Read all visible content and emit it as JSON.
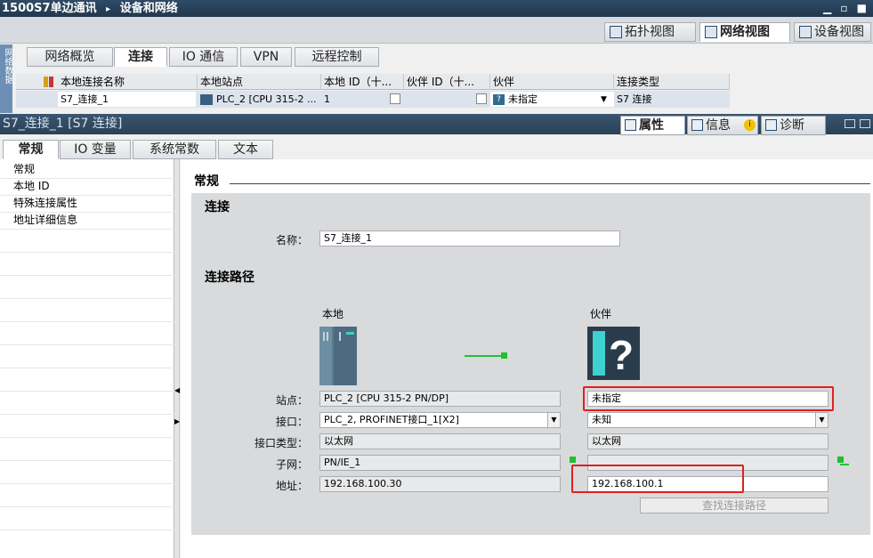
{
  "title": {
    "breadcrumb": "1500S7单边通讯",
    "separator": "▸",
    "current": "设备和网络"
  },
  "window_controls": "▁ ▫ ■",
  "views": [
    {
      "label": "拓扑视图",
      "active": false
    },
    {
      "label": "网络视图",
      "active": true
    },
    {
      "label": "设备视图",
      "active": false
    }
  ],
  "side_strip_label": "网络数据",
  "network_tabs": [
    "网络概览",
    "连接",
    "IO 通信",
    "VPN",
    "远程控制"
  ],
  "network_active_tab": "连接",
  "grid": {
    "headers": [
      "本地连接名称",
      "本地站点",
      "本地 ID（十...",
      "伙伴 ID（十...",
      "伙伴",
      "连接类型"
    ],
    "row": {
      "name": "S7_连接_1",
      "station": "PLC_2 [CPU 315-2 ...",
      "local_id": "1",
      "partner_id": "",
      "partner": "未指定",
      "type": "S7 连接"
    }
  },
  "property_title": "S7_连接_1 [S7 连接]",
  "property_tabs": [
    {
      "label": "属性",
      "active": true
    },
    {
      "label": "信息",
      "active": false
    },
    {
      "label": "诊断",
      "active": false
    }
  ],
  "sub_tabs": [
    "常规",
    "IO 变量",
    "系统常数",
    "文本"
  ],
  "sub_active": "常规",
  "nav_items": [
    "常规",
    "本地 ID",
    "特殊连接属性",
    "地址详细信息"
  ],
  "general_header": "常规",
  "connection_header": "连接",
  "name_label": "名称：",
  "name_value": "S7_连接_1",
  "path_header": "连接路径",
  "local_label": "本地",
  "partner_label": "伙伴",
  "rows": {
    "station": {
      "label": "站点：",
      "local": "PLC_2 [CPU 315-2 PN/DP]",
      "partner": "未指定"
    },
    "interface": {
      "label": "接口：",
      "local": "PLC_2, PROFINET接口_1[X2]",
      "partner": "未知"
    },
    "iface_type": {
      "label": "接口类型：",
      "local": "以太网",
      "partner": "以太网"
    },
    "subnet": {
      "label": "子网：",
      "local": "PN/IE_1",
      "partner": ""
    },
    "address": {
      "label": "地址：",
      "local": "192.168.100.30",
      "partner": "192.168.100.1"
    }
  },
  "find_path_button": "查找连接路径",
  "colors": {
    "accent": "#2f4b66",
    "highlight": "#e02020",
    "link": "#22c03a"
  }
}
